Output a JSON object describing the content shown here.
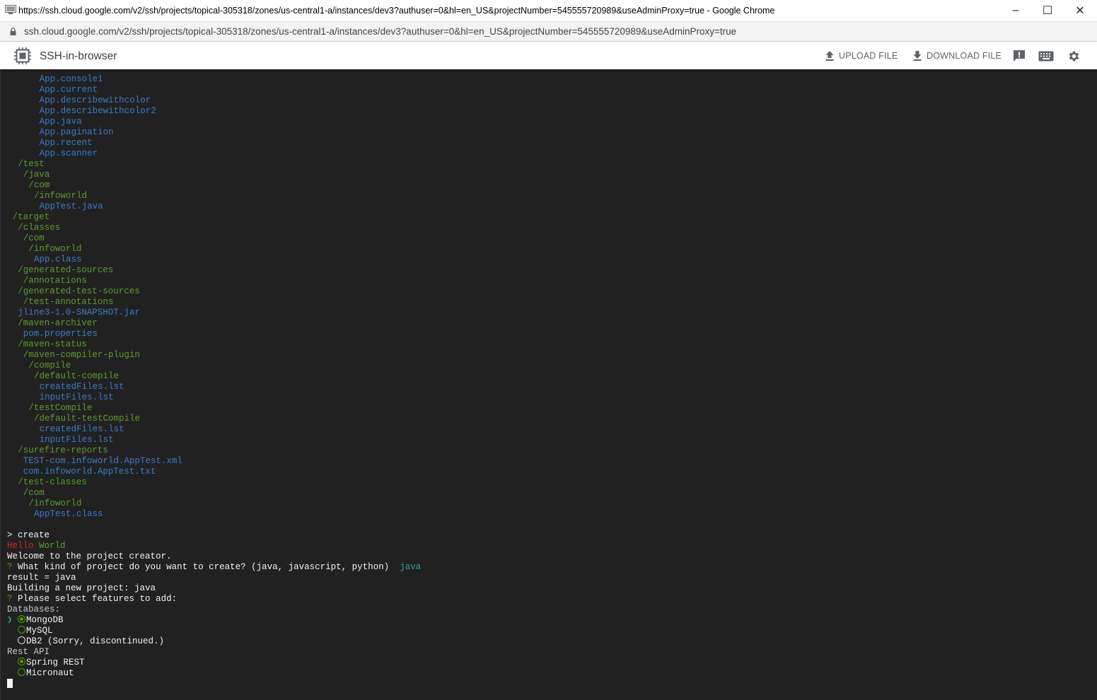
{
  "window": {
    "title": "https://ssh.cloud.google.com/v2/ssh/projects/topical-305318/zones/us-central1-a/instances/dev3?authuser=0&hl=en_US&projectNumber=545555720989&useAdminProxy=true - Google Chrome",
    "url": "ssh.cloud.google.com/v2/ssh/projects/topical-305318/zones/us-central1-a/instances/dev3?authuser=0&hl=en_US&projectNumber=545555720989&useAdminProxy=true",
    "controls": {
      "minimize": "–",
      "maximize": "☐",
      "close": "✕"
    }
  },
  "appbar": {
    "title": "SSH-in-browser",
    "upload_label": "UPLOAD FILE",
    "download_label": "DOWNLOAD FILE",
    "icons": [
      "chip-icon",
      "upload-icon",
      "download-icon",
      "feedback-icon",
      "keyboard-icon",
      "settings-icon"
    ]
  },
  "colors": {
    "terminal_bg": "#212121",
    "file": "#3a7cc8",
    "directory": "#5a9e2c",
    "text": "#f2f2f2",
    "error_red": "#c42a2a",
    "answer_teal": "#2fa3a3"
  },
  "terminal": {
    "tree": [
      {
        "indent": "      ",
        "text": "App.console1",
        "kind": "file"
      },
      {
        "indent": "      ",
        "text": "App.current",
        "kind": "file"
      },
      {
        "indent": "      ",
        "text": "App.describewithcolor",
        "kind": "file"
      },
      {
        "indent": "      ",
        "text": "App.describewithcolor2",
        "kind": "file"
      },
      {
        "indent": "      ",
        "text": "App.java",
        "kind": "file"
      },
      {
        "indent": "      ",
        "text": "App.pagination",
        "kind": "file"
      },
      {
        "indent": "      ",
        "text": "App.recent",
        "kind": "file"
      },
      {
        "indent": "      ",
        "text": "App.scanner",
        "kind": "file"
      },
      {
        "indent": "  ",
        "text": "/test",
        "kind": "dir"
      },
      {
        "indent": "   ",
        "text": "/java",
        "kind": "dir"
      },
      {
        "indent": "    ",
        "text": "/com",
        "kind": "dir"
      },
      {
        "indent": "     ",
        "text": "/infoworld",
        "kind": "dir"
      },
      {
        "indent": "      ",
        "text": "AppTest.java",
        "kind": "file"
      },
      {
        "indent": " ",
        "text": "/target",
        "kind": "dir"
      },
      {
        "indent": "  ",
        "text": "/classes",
        "kind": "dir"
      },
      {
        "indent": "   ",
        "text": "/com",
        "kind": "dir"
      },
      {
        "indent": "    ",
        "text": "/infoworld",
        "kind": "dir"
      },
      {
        "indent": "     ",
        "text": "App.class",
        "kind": "file"
      },
      {
        "indent": "  ",
        "text": "/generated-sources",
        "kind": "dir"
      },
      {
        "indent": "   ",
        "text": "/annotations",
        "kind": "dir"
      },
      {
        "indent": "  ",
        "text": "/generated-test-sources",
        "kind": "dir"
      },
      {
        "indent": "   ",
        "text": "/test-annotations",
        "kind": "dir"
      },
      {
        "indent": "  ",
        "text": "jline3-1.0-SNAPSHOT.jar",
        "kind": "file"
      },
      {
        "indent": "  ",
        "text": "/maven-archiver",
        "kind": "dir"
      },
      {
        "indent": "   ",
        "text": "pom.properties",
        "kind": "file"
      },
      {
        "indent": "  ",
        "text": "/maven-status",
        "kind": "dir"
      },
      {
        "indent": "   ",
        "text": "/maven-compiler-plugin",
        "kind": "dir"
      },
      {
        "indent": "    ",
        "text": "/compile",
        "kind": "dir"
      },
      {
        "indent": "     ",
        "text": "/default-compile",
        "kind": "dir"
      },
      {
        "indent": "      ",
        "text": "createdFiles.lst",
        "kind": "file"
      },
      {
        "indent": "      ",
        "text": "inputFiles.lst",
        "kind": "file"
      },
      {
        "indent": "    ",
        "text": "/testCompile",
        "kind": "dir"
      },
      {
        "indent": "     ",
        "text": "/default-testCompile",
        "kind": "dir"
      },
      {
        "indent": "      ",
        "text": "createdFiles.lst",
        "kind": "file"
      },
      {
        "indent": "      ",
        "text": "inputFiles.lst",
        "kind": "file"
      },
      {
        "indent": "  ",
        "text": "/surefire-reports",
        "kind": "dir"
      },
      {
        "indent": "   ",
        "text": "TEST-com.infoworld.AppTest.xml",
        "kind": "file"
      },
      {
        "indent": "   ",
        "text": "com.infoworld.AppTest.txt",
        "kind": "file"
      },
      {
        "indent": "  ",
        "text": "/test-classes",
        "kind": "dir"
      },
      {
        "indent": "   ",
        "text": "/com",
        "kind": "dir"
      },
      {
        "indent": "    ",
        "text": "/infoworld",
        "kind": "dir"
      },
      {
        "indent": "     ",
        "text": "AppTest.class",
        "kind": "file"
      }
    ],
    "command": "> create",
    "hello_word1": "Hello",
    "hello_word2": "World",
    "welcome": "Welcome to the project creator.",
    "q_mark": "?",
    "question1": "What kind of project do you want to create? (java, javascript, python)",
    "answer1": "java",
    "result": "result = java",
    "building": "Building a new project: java",
    "question2": "Please select features to add:",
    "databases_label": "Databases:",
    "pointer": "❯",
    "db_options": [
      {
        "label": "MongoDB",
        "selected": true
      },
      {
        "label": "MySQL",
        "selected": false
      },
      {
        "label": "DB2 (Sorry, discontinued.)",
        "selected": false
      }
    ],
    "rest_label": "Rest API",
    "rest_options": [
      {
        "label": "Spring REST",
        "selected": true
      },
      {
        "label": "Micronaut",
        "selected": false
      }
    ]
  }
}
